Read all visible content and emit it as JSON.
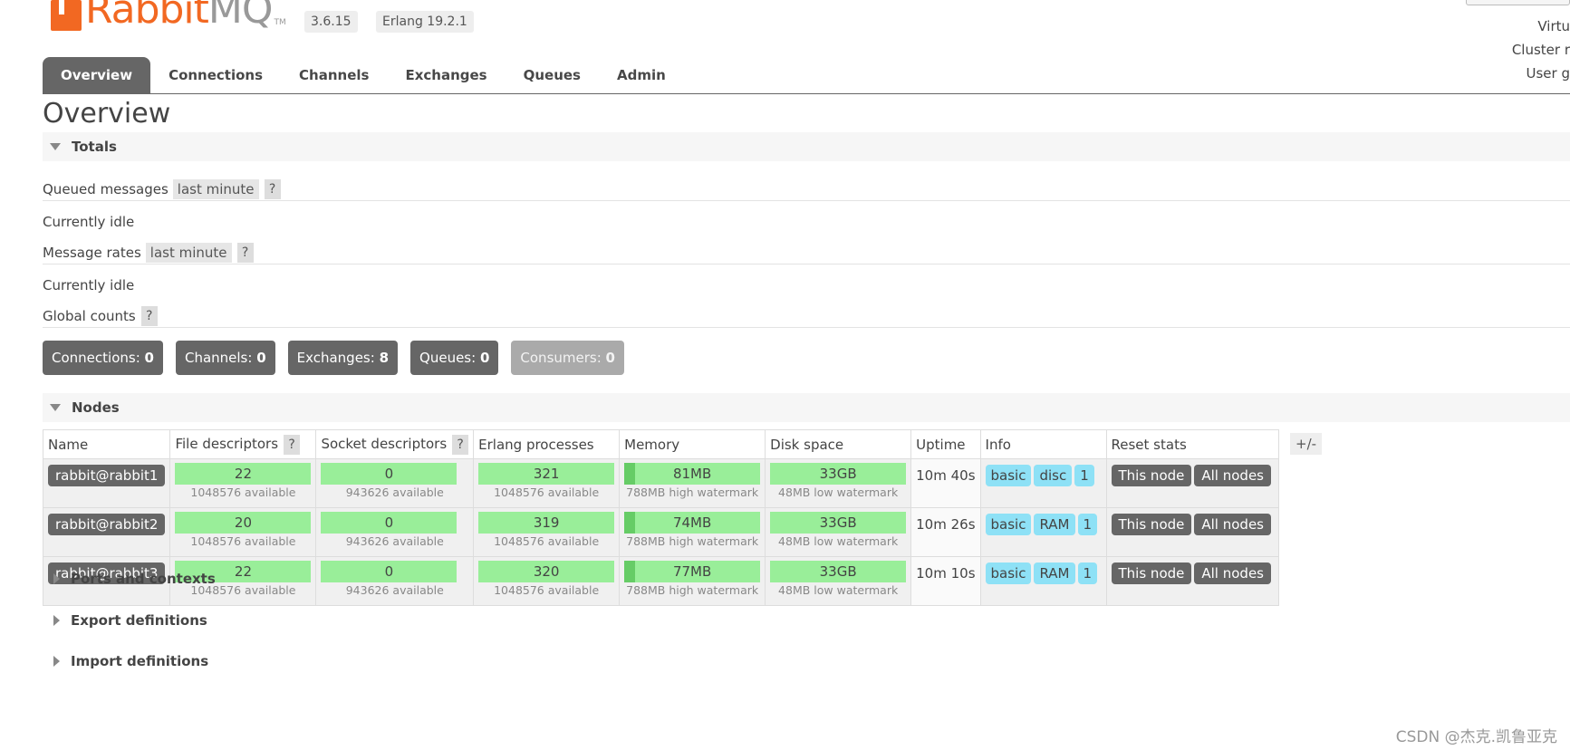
{
  "brand": {
    "logo_main": "Rabbit",
    "logo_suffix": "MQ",
    "logo_tm": "TM"
  },
  "header": {
    "version": "3.6.15",
    "erlang": "Erlang 19.2.1",
    "right_lines": [
      "Virtu",
      "Cluster r",
      "User g"
    ]
  },
  "tabs": [
    {
      "label": "Overview",
      "active": true
    },
    {
      "label": "Connections"
    },
    {
      "label": "Channels"
    },
    {
      "label": "Exchanges"
    },
    {
      "label": "Queues"
    },
    {
      "label": "Admin"
    }
  ],
  "page_title": "Overview",
  "totals": {
    "heading": "Totals",
    "queued_label": "Queued messages",
    "queued_range": "last minute",
    "help": "?",
    "queued_status": "Currently idle",
    "rates_label": "Message rates",
    "rates_range": "last minute",
    "rates_status": "Currently idle",
    "global_label": "Global counts"
  },
  "counts": [
    {
      "label": "Connections:",
      "value": "0"
    },
    {
      "label": "Channels:",
      "value": "0"
    },
    {
      "label": "Exchanges:",
      "value": "8"
    },
    {
      "label": "Queues:",
      "value": "0"
    },
    {
      "label": "Consumers:",
      "value": "0"
    }
  ],
  "nodes": {
    "heading": "Nodes",
    "plus_minus": "+/-",
    "columns": [
      "Name",
      "File descriptors",
      "Socket descriptors",
      "Erlang processes",
      "Memory",
      "Disk space",
      "Uptime",
      "Info",
      "Reset stats"
    ],
    "rows": [
      {
        "name": "rabbit@rabbit1",
        "fd": "22",
        "fd_sub": "1048576 available",
        "sd": "0",
        "sd_sub": "943626 available",
        "ep": "321",
        "ep_sub": "1048576 available",
        "mem": "81MB",
        "mem_sub": "788MB high watermark",
        "mem_fraction": 0.08,
        "disk": "33GB",
        "disk_sub": "48MB low watermark",
        "uptime": "10m 40s",
        "info": [
          "basic",
          "disc",
          "1"
        ],
        "reset": [
          "This node",
          "All nodes"
        ]
      },
      {
        "name": "rabbit@rabbit2",
        "fd": "20",
        "fd_sub": "1048576 available",
        "sd": "0",
        "sd_sub": "943626 available",
        "ep": "319",
        "ep_sub": "1048576 available",
        "mem": "74MB",
        "mem_sub": "788MB high watermark",
        "mem_fraction": 0.08,
        "disk": "33GB",
        "disk_sub": "48MB low watermark",
        "uptime": "10m 26s",
        "info": [
          "basic",
          "RAM",
          "1"
        ],
        "reset": [
          "This node",
          "All nodes"
        ]
      },
      {
        "name": "rabbit@rabbit3",
        "fd": "22",
        "fd_sub": "1048576 available",
        "sd": "0",
        "sd_sub": "943626 available",
        "ep": "320",
        "ep_sub": "1048576 available",
        "mem": "77MB",
        "mem_sub": "788MB high watermark",
        "mem_fraction": 0.08,
        "disk": "33GB",
        "disk_sub": "48MB low watermark",
        "uptime": "10m 10s",
        "info": [
          "basic",
          "RAM",
          "1"
        ],
        "reset": [
          "This node",
          "All nodes"
        ]
      }
    ]
  },
  "collapsed_sections": [
    "Ports and contexts",
    "Export definitions",
    "Import definitions"
  ],
  "watermark": "CSDN @杰克.凯鲁亚克"
}
